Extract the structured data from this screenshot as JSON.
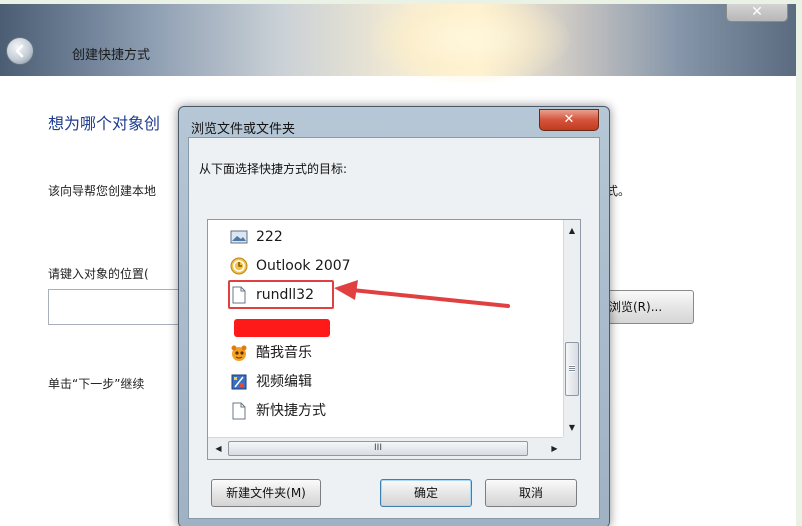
{
  "wizard": {
    "title": "创建快捷方式",
    "heading": "想为哪个对象创",
    "description": "该向导帮您创建本地",
    "description_tail": "式。",
    "location_label": "请键入对象的位置(",
    "location_value": "",
    "browse_label": "浏览(R)...",
    "hint": "单击“下一步”继续"
  },
  "dialog": {
    "title": "浏览文件或文件夹",
    "close_glyph": "✕",
    "prompt": "从下面选择快捷方式的目标:",
    "items": [
      {
        "label": "222",
        "icon": "image-icon"
      },
      {
        "label": "Outlook 2007",
        "icon": "outlook-icon"
      },
      {
        "label": "rundll32",
        "icon": "file-icon"
      },
      {
        "label": "",
        "icon": "redacted"
      },
      {
        "label": "酷我音乐",
        "icon": "kuwo-music-icon"
      },
      {
        "label": "视频编辑",
        "icon": "video-editor-icon"
      },
      {
        "label": "新快捷方式",
        "icon": "file-icon"
      }
    ],
    "scroll_grip": "III",
    "buttons": {
      "new_folder": "新建文件夹(M)",
      "ok": "确定",
      "cancel": "取消"
    }
  },
  "annotation": {
    "color": "#e14040",
    "highlighted_item": "rundll32"
  }
}
